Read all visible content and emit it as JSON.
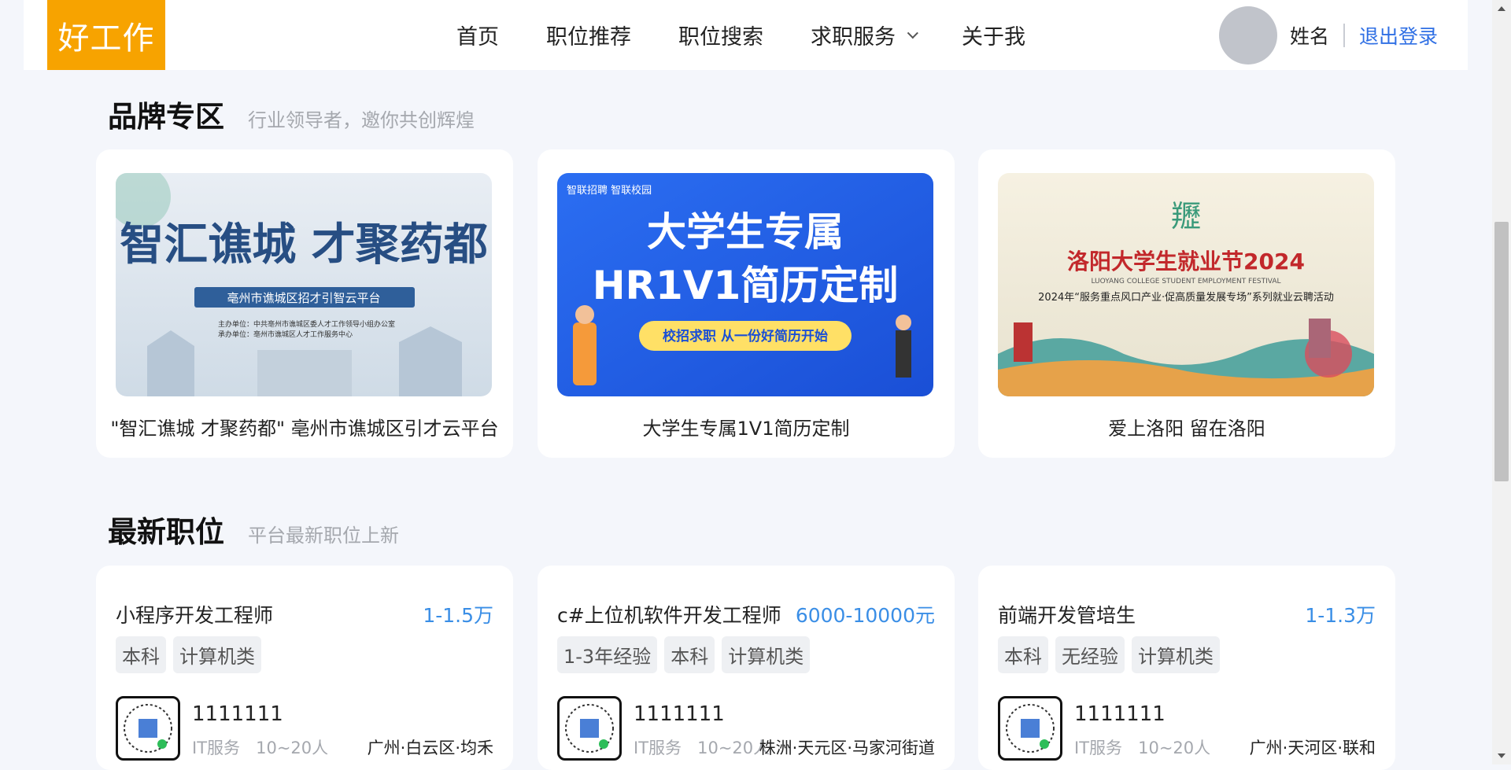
{
  "header": {
    "logo": "好工作",
    "nav": [
      {
        "label": "首页"
      },
      {
        "label": "职位推荐"
      },
      {
        "label": "职位搜索"
      },
      {
        "label": "求职服务"
      },
      {
        "label": "关于我"
      }
    ],
    "username": "姓名",
    "logout": "退出登录"
  },
  "brand_section": {
    "title": "品牌专区",
    "subtitle": "行业领导者，邀你共创辉煌",
    "cards": [
      {
        "caption": "\"智汇谯城 才聚药都\" 亳州市谯城区引才云平台",
        "banner_title": "智汇谯城 才聚药都",
        "banner_sub": "亳州市谯城区招才引智云平台",
        "banner_org1": "主办单位：中共亳州市谯城区委人才工作领导小组办公室",
        "banner_org2": "承办单位：亳州市谯城区人才工作服务中心"
      },
      {
        "caption": "大学生专属1V1简历定制",
        "banner_brand": "智联招聘 智联校园",
        "banner_line1": "大学生专属",
        "banner_line2": "HR1V1简历定制",
        "banner_pill": "校招求职  从一份好简历开始"
      },
      {
        "caption": "爱上洛阳 留在洛阳",
        "banner_title": "洛阳大学生就业节2024",
        "banner_en": "LUOYANG COLLEGE STUDENT EMPLOYMENT FESTIVAL",
        "banner_sub": "2024年“服务重点风口产业·促高质量发展专场”系列就业云聘活动"
      }
    ]
  },
  "jobs_section": {
    "title": "最新职位",
    "subtitle": "平台最新职位上新",
    "jobs": [
      {
        "title": "小程序开发工程师",
        "salary": "1-1.5万",
        "tags": [
          "本科",
          "计算机类"
        ],
        "company": "1111111",
        "industry": "IT服务",
        "size": "10~20人",
        "location": "广州·白云区·均禾"
      },
      {
        "title": "c#上位机软件开发工程师",
        "salary": "6000-10000元",
        "tags": [
          "1-3年经验",
          "本科",
          "计算机类"
        ],
        "company": "1111111",
        "industry": "IT服务",
        "size": "10~20人",
        "location": "株洲·天元区·马家河街道"
      },
      {
        "title": "前端开发管培生",
        "salary": "1-1.3万",
        "tags": [
          "本科",
          "无经验",
          "计算机类"
        ],
        "company": "1111111",
        "industry": "IT服务",
        "size": "10~20人",
        "location": "广州·天河区·联和"
      }
    ]
  },
  "colors": {
    "brand": "#f7a300",
    "link": "#2f6fe4",
    "salary": "#3a8ee6",
    "background": "#f4f6fb"
  }
}
